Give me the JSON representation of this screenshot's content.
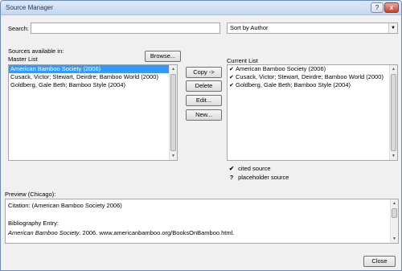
{
  "window": {
    "title": "Source Manager",
    "help_label": "?",
    "close_label": "x"
  },
  "search": {
    "label": "Search:",
    "value": "",
    "placeholder": ""
  },
  "sort": {
    "selected": "Sort by Author"
  },
  "sources_label": "Sources available in:",
  "master_list": {
    "label": "Master List",
    "browse_label": "Browse...",
    "items": [
      "American Bamboo Society (2006)",
      "Cusack, Victor; Stewart, Deirdre; Bamboo World (2000)",
      "Goldberg, Gale Beth; Bamboo Style (2004)"
    ]
  },
  "actions": {
    "copy_label": "Copy ->",
    "delete_label": "Delete",
    "edit_label": "Edit...",
    "new_label": "New..."
  },
  "current_list": {
    "label": "Current List",
    "items": [
      "American Bamboo Society (2006)",
      "Cusack, Victor; Stewart, Deirdre; Bamboo World (2000)",
      "Goldberg, Gale Beth; Bamboo Style (2004)"
    ]
  },
  "legend": {
    "cited_symbol": "✔",
    "cited_label": "cited source",
    "placeholder_symbol": "?",
    "placeholder_label": "placeholder source"
  },
  "preview": {
    "label": "Preview (Chicago):",
    "citation": "Citation:  (American Bamboo Society 2006)",
    "bibliography_heading": "Bibliography Entry:",
    "entry_italic": "American Bamboo Society",
    "entry_rest": ". 2006. www.americanbamboo.org/BooksOnBamboo.html."
  },
  "close_button_label": "Close",
  "icons": {
    "check": "check-icon",
    "scroll_up": "scroll-up-icon",
    "scroll_down": "scroll-down-icon",
    "dropdown": "chevron-down-icon"
  }
}
